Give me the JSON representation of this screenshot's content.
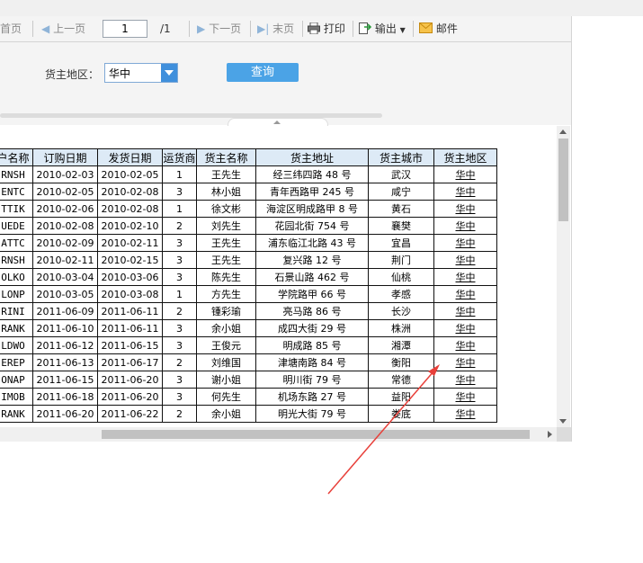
{
  "toolbar": {
    "first_page": "首页",
    "prev_page": "上一页",
    "current_page": "1",
    "total_pages": "/1",
    "next_page": "下一页",
    "last_page": "末页",
    "print": "打印",
    "export": "输出",
    "mail": "邮件"
  },
  "params": {
    "region_label": "货主地区：",
    "region_value": "华中",
    "query_label": "查询"
  },
  "table": {
    "headers": [
      "户名称",
      "订购日期",
      "发货日期",
      "运货商",
      "货主名称",
      "货主地址",
      "货主城市",
      "货主地区"
    ],
    "rows": [
      [
        "RNSH",
        "2010-02-03",
        "2010-02-05",
        "1",
        "王先生",
        "经三纬四路 48 号",
        "武汉",
        "华中"
      ],
      [
        "ENTC",
        "2010-02-05",
        "2010-02-08",
        "3",
        "林小姐",
        "青年西路甲 245 号",
        "咸宁",
        "华中"
      ],
      [
        "TTIK",
        "2010-02-06",
        "2010-02-08",
        "1",
        "徐文彬",
        "海淀区明成路甲 8 号",
        "黄石",
        "华中"
      ],
      [
        "UEDE",
        "2010-02-08",
        "2010-02-10",
        "2",
        "刘先生",
        "花园北街 754 号",
        "襄樊",
        "华中"
      ],
      [
        "ATTC",
        "2010-02-09",
        "2010-02-11",
        "3",
        "王先生",
        "浦东临江北路 43 号",
        "宜昌",
        "华中"
      ],
      [
        "RNSH",
        "2010-02-11",
        "2010-02-15",
        "3",
        "王先生",
        "复兴路 12 号",
        "荆门",
        "华中"
      ],
      [
        "OLKO",
        "2010-03-04",
        "2010-03-06",
        "3",
        "陈先生",
        "石景山路 462 号",
        "仙桃",
        "华中"
      ],
      [
        "LONP",
        "2010-03-05",
        "2010-03-08",
        "1",
        "方先生",
        "学院路甲 66 号",
        "孝感",
        "华中"
      ],
      [
        "RINI",
        "2011-06-09",
        "2011-06-11",
        "2",
        "锺彩瑜",
        "亮马路 86 号",
        "长沙",
        "华中"
      ],
      [
        "RANK",
        "2011-06-10",
        "2011-06-11",
        "3",
        "余小姐",
        "成四大街 29 号",
        "株洲",
        "华中"
      ],
      [
        "LDWO",
        "2011-06-12",
        "2011-06-15",
        "3",
        "王俊元",
        "明成路 85 号",
        "湘潭",
        "华中"
      ],
      [
        "EREP",
        "2011-06-13",
        "2011-06-17",
        "2",
        "刘维国",
        "津塘南路 84 号",
        "衡阳",
        "华中"
      ],
      [
        "ONAP",
        "2011-06-15",
        "2011-06-20",
        "3",
        "谢小姐",
        "明川街 79 号",
        "常德",
        "华中"
      ],
      [
        "IMOB",
        "2011-06-18",
        "2011-06-20",
        "3",
        "何先生",
        "机场东路 27 号",
        "益阳",
        "华中"
      ],
      [
        "RANK",
        "2011-06-20",
        "2011-06-22",
        "2",
        "余小姐",
        "明光大街 79 号",
        "娄底",
        "华中"
      ]
    ]
  },
  "colors": {
    "header_bg": "#ddeaf6",
    "query_button": "#4ba3e6",
    "link": "#0000ee",
    "annotation_arrow": "#e8403a"
  }
}
